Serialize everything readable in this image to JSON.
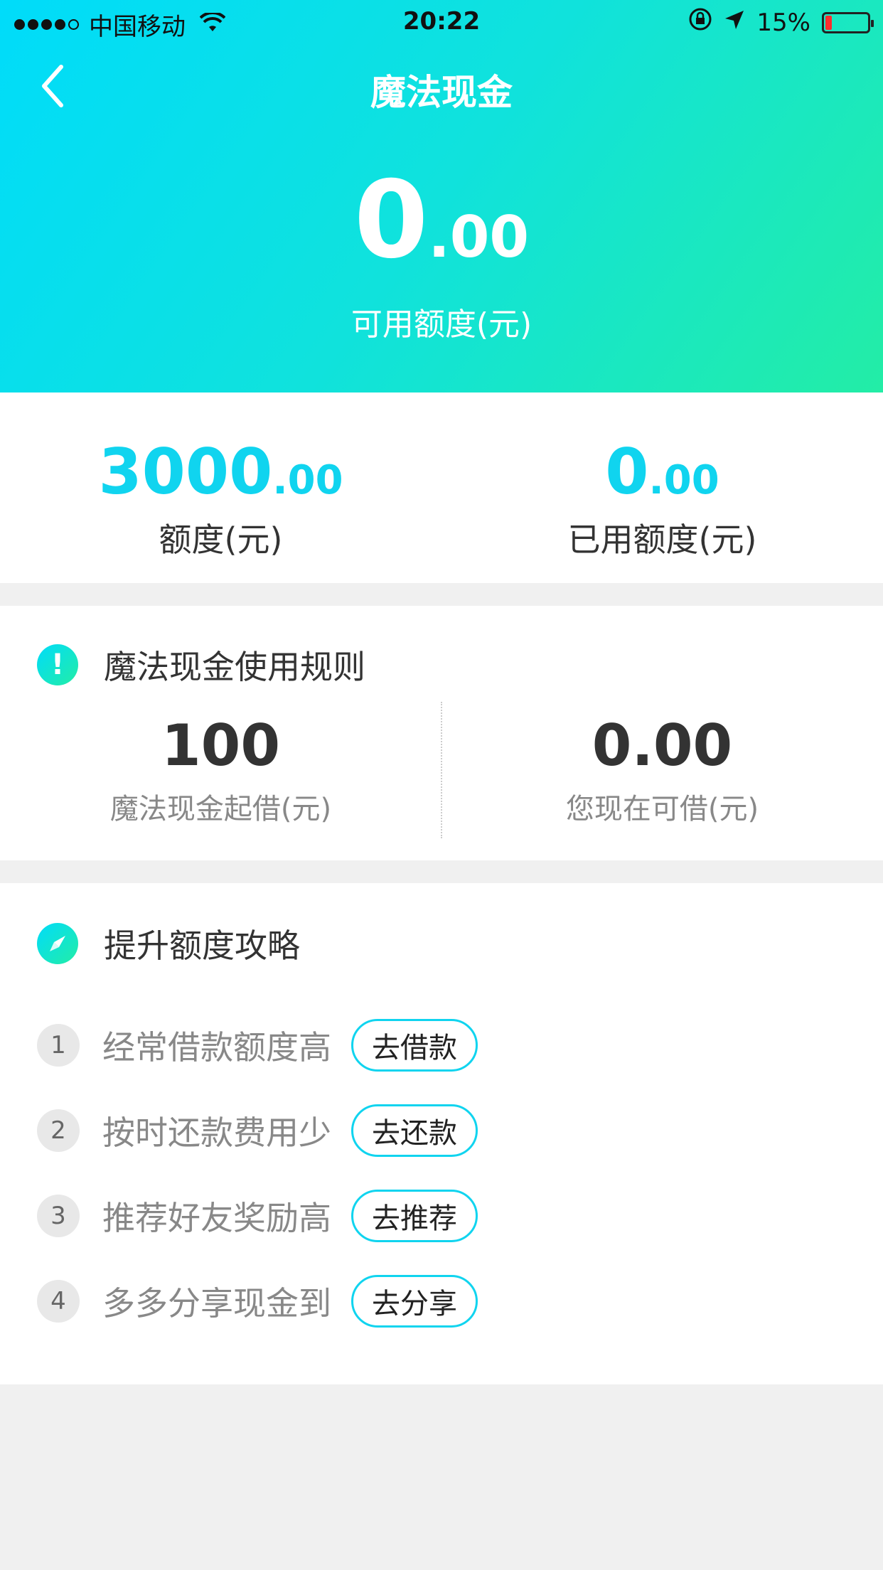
{
  "status_bar": {
    "carrier": "中国移动",
    "time": "20:22",
    "battery_percent": "15%",
    "battery_level": 0.15,
    "battery_color": "#ff2d2d",
    "icons": [
      "signal-dots",
      "wifi-icon",
      "orientation-lock-icon",
      "location-arrow-icon",
      "battery-icon"
    ]
  },
  "nav": {
    "title": "魔法现金",
    "back_icon": "chevron-left-icon"
  },
  "balance": {
    "integer": "0",
    "decimal": ".00",
    "label": "可用额度(元)"
  },
  "quota": {
    "total": {
      "integer": "3000",
      "decimal": ".00",
      "label": "额度(元)"
    },
    "used": {
      "integer": "0",
      "decimal": ".00",
      "label": "已用额度(元)"
    }
  },
  "rules": {
    "title": "魔法现金使用规则",
    "icon": "exclamation-circle-icon",
    "min_borrow": {
      "value": "100",
      "label": "魔法现金起借(元)"
    },
    "available": {
      "value": "0.00",
      "label": "您现在可借(元)"
    }
  },
  "tips": {
    "title": "提升额度攻略",
    "icon": "compass-icon",
    "items": [
      {
        "num": "1",
        "text": "经常借款额度高",
        "button": "去借款"
      },
      {
        "num": "2",
        "text": "按时还款费用少",
        "button": "去还款"
      },
      {
        "num": "3",
        "text": "推荐好友奖励高",
        "button": "去推荐"
      },
      {
        "num": "4",
        "text": "多多分享现金到",
        "button": "去分享"
      }
    ]
  },
  "colors": {
    "accent": "#10d4ef",
    "gradient_start": "#00dcfa",
    "gradient_end": "#23eda6",
    "background": "#f0f0f0"
  }
}
